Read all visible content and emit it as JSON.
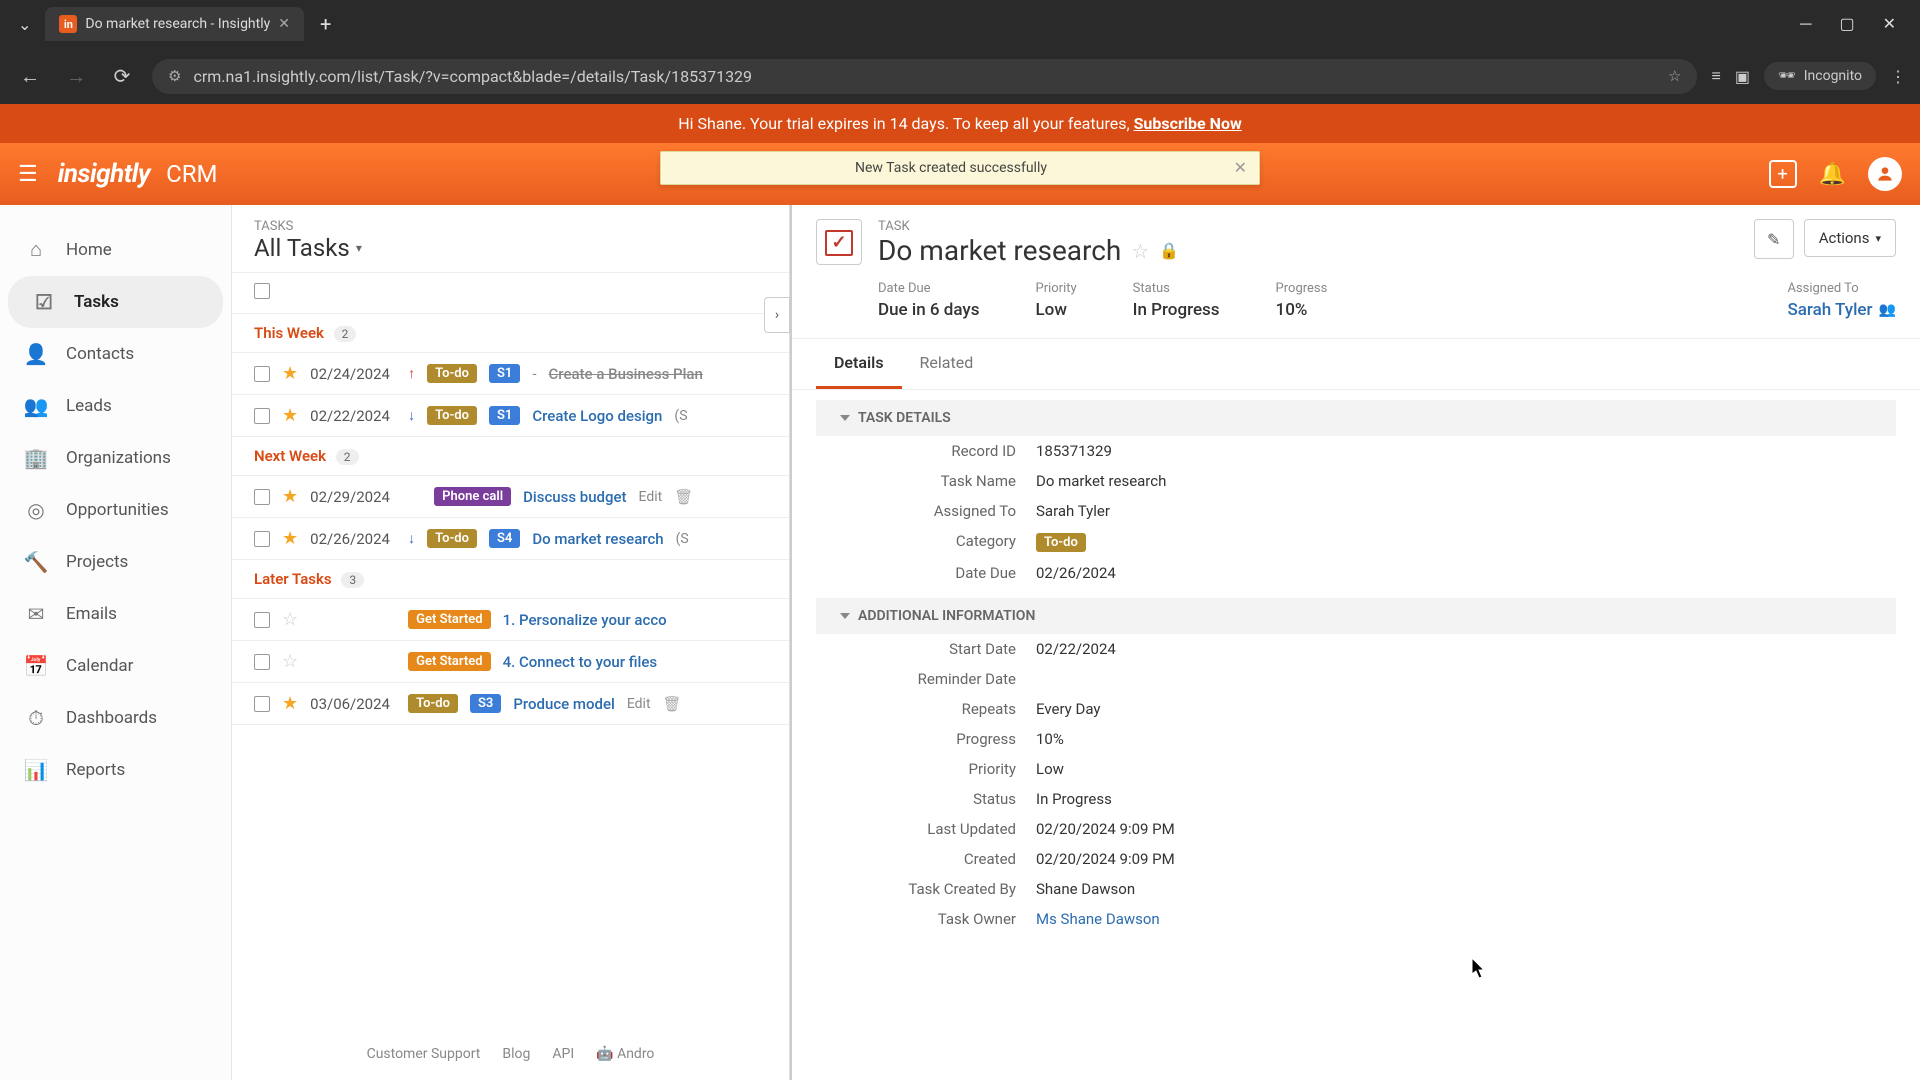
{
  "browser": {
    "tab_title": "Do market research - Insightly",
    "url": "crm.na1.insightly.com/list/Task/?v=compact&blade=/details/Task/185371329",
    "incognito": "Incognito"
  },
  "trial_banner": {
    "greeting": "Hi Shane. Your trial expires in 14 days. To keep all your features, ",
    "cta": "Subscribe Now"
  },
  "app": {
    "logo": "insightly",
    "name": "CRM"
  },
  "toast": {
    "message": "New Task created successfully"
  },
  "nav": {
    "items": [
      {
        "label": "Home"
      },
      {
        "label": "Tasks"
      },
      {
        "label": "Contacts"
      },
      {
        "label": "Leads"
      },
      {
        "label": "Organizations"
      },
      {
        "label": "Opportunities"
      },
      {
        "label": "Projects"
      },
      {
        "label": "Emails"
      },
      {
        "label": "Calendar"
      },
      {
        "label": "Dashboards"
      },
      {
        "label": "Reports"
      }
    ]
  },
  "list": {
    "eyebrow": "TASKS",
    "title": "All Tasks",
    "groups": [
      {
        "name": "This Week",
        "count": "2",
        "tasks": [
          {
            "date": "02/24/2024",
            "starred": true,
            "priority": "high",
            "category": "To-do",
            "stage": "S1",
            "title": "Create a Business Plan",
            "struck": true
          },
          {
            "date": "02/22/2024",
            "starred": true,
            "priority": "low",
            "category": "To-do",
            "stage": "S1",
            "title": "Create Logo design",
            "meta": "(S"
          }
        ]
      },
      {
        "name": "Next Week",
        "count": "2",
        "tasks": [
          {
            "date": "02/29/2024",
            "starred": true,
            "category": "Phone call",
            "title": "Discuss budget",
            "edit": "Edit"
          },
          {
            "date": "02/26/2024",
            "starred": true,
            "priority": "low",
            "category": "To-do",
            "stage": "S4",
            "title": "Do market research",
            "meta": "(S"
          }
        ]
      },
      {
        "name": "Later Tasks",
        "count": "3",
        "tasks": [
          {
            "starred": false,
            "category": "Get Started",
            "title": "1. Personalize your acco"
          },
          {
            "starred": false,
            "category": "Get Started",
            "title": "4. Connect to your files"
          },
          {
            "date": "03/06/2024",
            "starred": true,
            "category": "To-do",
            "stage": "S3",
            "title": "Produce model",
            "edit": "Edit"
          }
        ]
      }
    ]
  },
  "footer": {
    "customer_support": "Customer Support",
    "blog": "Blog",
    "api": "API",
    "android": "Andro"
  },
  "detail": {
    "eyebrow": "TASK",
    "title": "Do market research",
    "actions": "Actions",
    "summary": {
      "due_label": "Date Due",
      "due_value": "Due in 6 days",
      "priority_label": "Priority",
      "priority_value": "Low",
      "status_label": "Status",
      "status_value": "In Progress",
      "progress_label": "Progress",
      "progress_value": "10%",
      "assigned_label": "Assigned To",
      "assigned_value": "Sarah Tyler"
    },
    "tabs": {
      "details": "Details",
      "related": "Related"
    },
    "sections": {
      "task_details": "TASK DETAILS",
      "additional": "ADDITIONAL INFORMATION"
    },
    "fields": {
      "record_id": {
        "label": "Record ID",
        "value": "185371329"
      },
      "task_name": {
        "label": "Task Name",
        "value": "Do market research"
      },
      "assigned_to": {
        "label": "Assigned To",
        "value": "Sarah Tyler"
      },
      "category": {
        "label": "Category",
        "value": "To-do"
      },
      "date_due": {
        "label": "Date Due",
        "value": "02/26/2024"
      },
      "start_date": {
        "label": "Start Date",
        "value": "02/22/2024"
      },
      "reminder": {
        "label": "Reminder Date",
        "value": ""
      },
      "repeats": {
        "label": "Repeats",
        "value": "Every Day"
      },
      "progress": {
        "label": "Progress",
        "value": "10%"
      },
      "priority": {
        "label": "Priority",
        "value": "Low"
      },
      "status": {
        "label": "Status",
        "value": "In Progress"
      },
      "last_updated": {
        "label": "Last Updated",
        "value": "02/20/2024 9:09 PM"
      },
      "created": {
        "label": "Created",
        "value": "02/20/2024 9:09 PM"
      },
      "created_by": {
        "label": "Task Created By",
        "value": "Shane Dawson"
      },
      "owner": {
        "label": "Task Owner",
        "value": "Ms Shane Dawson"
      }
    }
  }
}
